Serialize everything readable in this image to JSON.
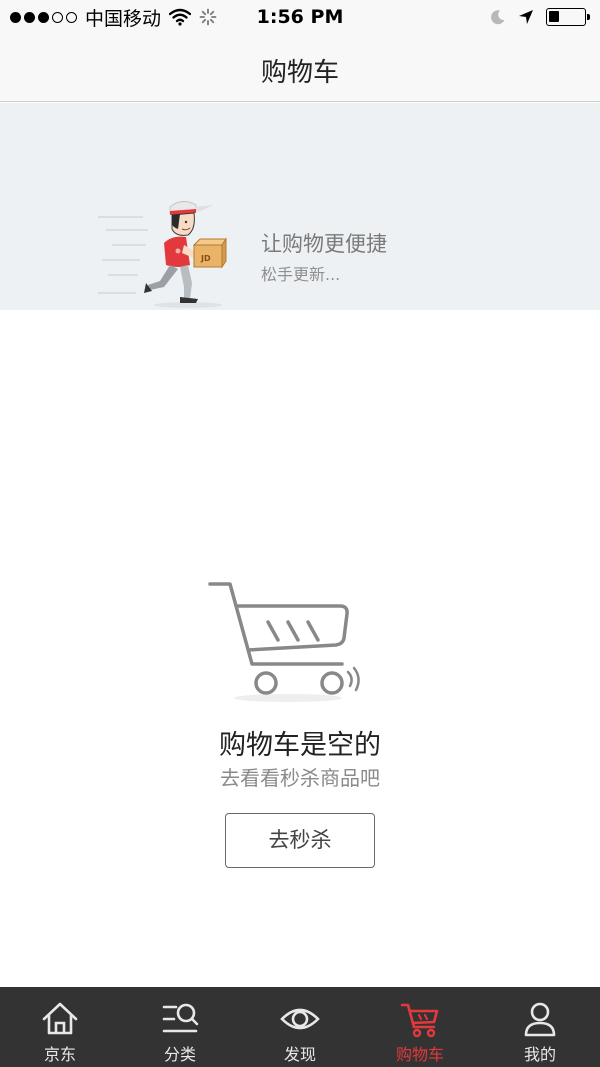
{
  "status_bar": {
    "carrier": "中国移动",
    "time": "1:56 PM",
    "signal_filled": 3,
    "signal_total": 5,
    "battery_level": 0.3
  },
  "nav": {
    "title": "购物车"
  },
  "refresh": {
    "title": "让购物更便捷",
    "subtitle": "松手更新...",
    "box_label": "JD"
  },
  "empty_cart": {
    "title": "购物车是空的",
    "subtitle": "去看看秒杀商品吧",
    "button_label": "去秒杀"
  },
  "tabs": [
    {
      "label": "京东",
      "icon": "home-icon",
      "active": false
    },
    {
      "label": "分类",
      "icon": "category-search-icon",
      "active": false
    },
    {
      "label": "发现",
      "icon": "eye-icon",
      "active": false
    },
    {
      "label": "购物车",
      "icon": "cart-icon",
      "active": true
    },
    {
      "label": "我的",
      "icon": "user-icon",
      "active": false
    }
  ],
  "colors": {
    "accent": "#e4393c",
    "tab_bar_bg": "#333333",
    "refresh_bg": "#eef1f4"
  }
}
